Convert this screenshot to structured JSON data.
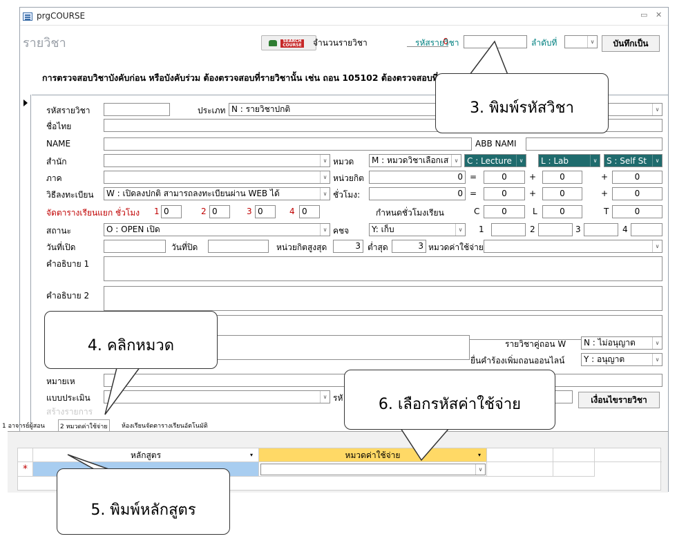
{
  "window": {
    "title": "prgCOURSE",
    "minimize_icon": "minimize-icon",
    "close_icon": "close-icon"
  },
  "header": {
    "form_title": "รายวิชา",
    "search_button": {
      "tag_top": "SEARCH",
      "tag_bottom": "COURSE"
    },
    "course_count_label": "จำนวนรายวิชา",
    "course_count_value": "0",
    "course_code_label": "รหัสรายวิชา",
    "course_code_value": "",
    "order_label": "ลำดับที่",
    "order_value": "",
    "save_button": "บันทึกเป็น",
    "notice": "การตรวจสอบวิชาบังคับก่อน หรือบังคับร่วม ต้องตรวจสอบที่รายวิชานั้น เช่น ถอน 105102 ต้องตรวจสอบที่วิชา 105102 เป็นต้น"
  },
  "form": {
    "course_code": {
      "label": "รหัสรายวิชา",
      "value": ""
    },
    "type": {
      "label": "ประเภท",
      "value": "N : รายวิชาปกติ"
    },
    "thai_name": {
      "label": "ชื่อไทย",
      "value": ""
    },
    "eng_name": {
      "label": "NAME",
      "value": ""
    },
    "abb_name": {
      "label": "ABB NAMI",
      "value": ""
    },
    "office": {
      "label": "สำนัก",
      "value": ""
    },
    "category": {
      "label": "หมวด",
      "value": "M : หมวดวิชาเลือกเส"
    },
    "lecture": "C : Lecture",
    "lab": "L : Lab",
    "self_study": "S : Self St",
    "department": {
      "label": "ภาค",
      "value": ""
    },
    "credit_unit": {
      "label": "หน่วยกิต",
      "value": "0"
    },
    "credit_c": "0",
    "credit_l": "0",
    "credit_s": "0",
    "registration": {
      "label": "วิธีลงทะเบียน",
      "value": "W : เปิดลงปกติ สามารถลงทะเบียนผ่าน WEB ได้"
    },
    "hours": {
      "label": "ชั่วโมง:",
      "value": "0"
    },
    "hours_c": "0",
    "hours_l": "0",
    "hours_s": "0",
    "split_schedule": {
      "label": "จัดตารางเรียนแยก ชั่วโมง",
      "v1_label": "1",
      "v1": "0",
      "v2_label": "2",
      "v2": "0",
      "v3_label": "3",
      "v3": "0",
      "v4_label": "4",
      "v4": "0"
    },
    "set_hours": {
      "label": "กำหนดชั่วโมงเรียน",
      "c_label": "C",
      "c": "0",
      "l_label": "L",
      "l": "0",
      "t_label": "T",
      "t": "0"
    },
    "status": {
      "label": "สถานะ",
      "value": "O : OPEN เปิด"
    },
    "kcj": {
      "label": "คชจ",
      "value": "Y: เก็บ"
    },
    "kcj_n1_label": "1",
    "kcj_n2_label": "2",
    "kcj_n3_label": "3",
    "kcj_n4_label": "4",
    "open_date": {
      "label": "วันที่เปิด",
      "value": ""
    },
    "close_date": {
      "label": "วันที่ปิด",
      "value": ""
    },
    "max_credit": {
      "label": "หน่วยกิตสูงสุด",
      "value": "3"
    },
    "min_credit": {
      "label": "ต่ำสุด",
      "value": "3"
    },
    "fee_category": {
      "label": "หมวดค่าใช้จ่าย",
      "value": ""
    },
    "desc1": {
      "label": "คำอธิบาย 1",
      "value": ""
    },
    "desc2": {
      "label": "คำอธิบาย 2",
      "value": ""
    },
    "pair_withdraw": {
      "label": "รายวิชาคู่ถอน W",
      "value": "N : ไม่อนุญาต"
    },
    "online_withdraw": {
      "label": "ยื่นคำร้องเพิ่มถอนออนไลน์",
      "value": "Y : อนุญาต"
    },
    "note_label": "หมายเห",
    "eval_label": "แบบประเมิน",
    "eval_value": "",
    "created_label": "สร้างรายการ",
    "code_partial": "รหั",
    "unfinish_button": "เงื่อนไขรายวิชา",
    "equals": "=",
    "plus": "+"
  },
  "tabs": [
    "1 อาจารย์ผู้สอน",
    "2 หมวดค่าใช้จ่าย",
    "ห้องเรียนจัดตารางเรียนอัตโนมัติ"
  ],
  "subgrid": {
    "columns": [
      "หลักสูตร",
      "หมวดค่าใช้จ่าย"
    ],
    "new_row_marker": "*"
  },
  "callouts": {
    "c3": "3. พิมพ์รหัสวิชา",
    "c4": "4. คลิกหมวด",
    "c5": "5. พิมพ์หลักสูตร",
    "c6": "6. เลือกรหัสค่าใช้จ่าย"
  },
  "colors": {
    "teal": "#008080",
    "red": "#c00000",
    "lab_fill": "#1f6b6d",
    "grid_header": "#ffd966",
    "grid_select": "#a8cdf0"
  }
}
